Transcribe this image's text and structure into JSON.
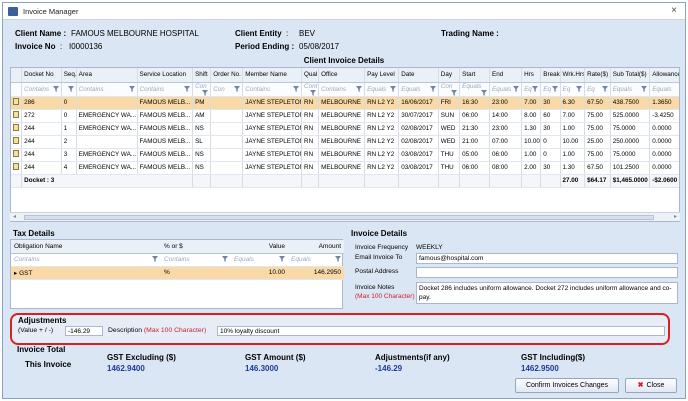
{
  "window": {
    "title": "Invoice Manager",
    "close_glyph": "×"
  },
  "header": {
    "client_name_label": "Client Name :",
    "client_name": "FAMOUS MELBOURNE HOSPITAL",
    "invoice_no_label": "Invoice No",
    "invoice_no_sep": ":",
    "invoice_no": "I0000136",
    "client_entity_label": "Client Entity",
    "client_entity_sep": ":",
    "client_entity": "BEV",
    "period_ending_label": "Period Ending :",
    "period_ending": "05/08/2017",
    "trading_name_label": "Trading Name :",
    "trading_name": ""
  },
  "client_invoice_details": {
    "title": "Client Invoice Details",
    "columns": [
      "",
      "Docket No",
      "Seq.",
      "Area",
      "Service Location",
      "Shift",
      "Order No.",
      "Member Name",
      "Qual",
      "Office",
      "Pay Level",
      "Date",
      "Day",
      "Start",
      "End",
      "Hrs",
      "Break",
      "Wrk.Hrs",
      "Rate($)",
      "Sub Total($)",
      "Allowances ($)"
    ],
    "filter_placeholders": [
      "",
      "Contains",
      "",
      "Contains",
      "Contains",
      "Con",
      "Con",
      "Contains",
      "Cont",
      "Contains",
      "Equals",
      "Equals",
      "Con",
      "Equals",
      "Equals",
      "Eq",
      "Eq",
      "Eq",
      "Eq",
      "Equals",
      "Equals"
    ],
    "rows": [
      [
        "",
        "286",
        "0",
        "",
        "FAMOUS MELB...",
        "PM",
        "",
        "JAYNE STEPLETON",
        "RN",
        "MELBOURNE",
        "RN L2 Y2",
        "16/06/2017",
        "FRI",
        "16:30",
        "23:00",
        "7.00",
        "30",
        "6.30",
        "67.50",
        "438.7500",
        "1.3650"
      ],
      [
        "",
        "272",
        "0",
        "EMERGENCY WA...",
        "FAMOUS MELB...",
        "AM",
        "",
        "JAYNE STEPLETON",
        "RN",
        "MELBOURNE",
        "RN L2 Y2",
        "30/07/2017",
        "SUN",
        "06:00",
        "14:00",
        "8.00",
        "60",
        "7.00",
        "75.00",
        "525.0000",
        "-3.4250"
      ],
      [
        "",
        "244",
        "1",
        "EMERGENCY WA...",
        "FAMOUS MELB...",
        "NS",
        "",
        "JAYNE STEPLETON",
        "RN",
        "MELBOURNE",
        "RN L2 Y2",
        "02/08/2017",
        "WED",
        "21:30",
        "23:00",
        "1.30",
        "30",
        "1.00",
        "75.00",
        "75.0000",
        "0.0000"
      ],
      [
        "",
        "244",
        "2",
        "",
        "FAMOUS MELB...",
        "SL",
        "",
        "JAYNE STEPLETON",
        "RN",
        "MELBOURNE",
        "RN L2 Y2",
        "02/08/2017",
        "WED",
        "21:00",
        "07:00",
        "10.00",
        "0",
        "10.00",
        "25.00",
        "250.0000",
        "0.0000"
      ],
      [
        "",
        "244",
        "3",
        "EMERGENCY WA...",
        "FAMOUS MELB...",
        "NS",
        "",
        "JAYNE STEPLETON",
        "RN",
        "MELBOURNE",
        "RN L2 Y2",
        "03/08/2017",
        "THU",
        "05:00",
        "06:00",
        "1.00",
        "0",
        "1.00",
        "75.00",
        "75.0000",
        "0.0000"
      ],
      [
        "",
        "244",
        "4",
        "EMERGENCY WA...",
        "FAMOUS MELB...",
        "NS",
        "",
        "JAYNE STEPLETON",
        "RN",
        "MELBOURNE",
        "RN L2 Y2",
        "03/08/2017",
        "THU",
        "06:00",
        "08:00",
        "2.00",
        "30",
        "1.30",
        "67.50",
        "101.2500",
        "0.0000"
      ]
    ],
    "summary": {
      "docket_label": "Docket : 3",
      "wrk_hrs": "27.00",
      "rate": "$64.17",
      "sub_total": "$1,465.0000",
      "allowances": "-$2.0600"
    }
  },
  "tax_details": {
    "title": "Tax Details",
    "columns": [
      "Obligation Name",
      "% or $",
      "Value",
      "Amount"
    ],
    "filter_placeholders": [
      "Contains",
      "Contains",
      "Equals",
      "Equals"
    ],
    "rows": [
      {
        "marker": "▸",
        "name": "GST",
        "type": "%",
        "value": "10.00",
        "amount": "146.2950"
      }
    ]
  },
  "invoice_details": {
    "title": "Invoice Details",
    "frequency_label": "Invoice Frequency",
    "frequency": "WEEKLY",
    "email_label": "Email Invoice To",
    "email": "famous@hospital.com",
    "postal_label": "Postal Address",
    "postal": "",
    "notes_label": "Invoice Notes",
    "notes_hint": "(Max 100 Character)",
    "notes": "Docket 286 includes uniform allowance. Docket 272 includes uniform allowance and co-pay."
  },
  "adjustments": {
    "title": "Adjustments",
    "value_label": "(Value + / -)",
    "value": "-146.29",
    "description_label": "Description",
    "description_hint": "(Max 100 Character)",
    "description": "10% loyalty discount"
  },
  "invoice_total": {
    "title": "Invoice Total",
    "row_label": "This Invoice",
    "gst_excluding_label": "GST Excluding ($)",
    "gst_excluding": "1462.9400",
    "gst_amount_label": "GST Amount ($)",
    "gst_amount": "146.3000",
    "adjustments_label": "Adjustments(if any)",
    "adjustments_value": "-146.29",
    "gst_including_label": "GST Including($)",
    "gst_including": "1462.9500"
  },
  "buttons": {
    "confirm": "Confirm Invoices Changes",
    "close": "Close"
  },
  "icons": {
    "app": "invoice-app-icon",
    "funnel": "filter-funnel-icon",
    "row": "row-record-icon",
    "close": "close-x-icon"
  },
  "colors": {
    "accent_red": "#d0202a",
    "selected_row": "#f9d9a6",
    "total_blue": "#1d3b9a",
    "window_bg": "#dbe6f4"
  }
}
